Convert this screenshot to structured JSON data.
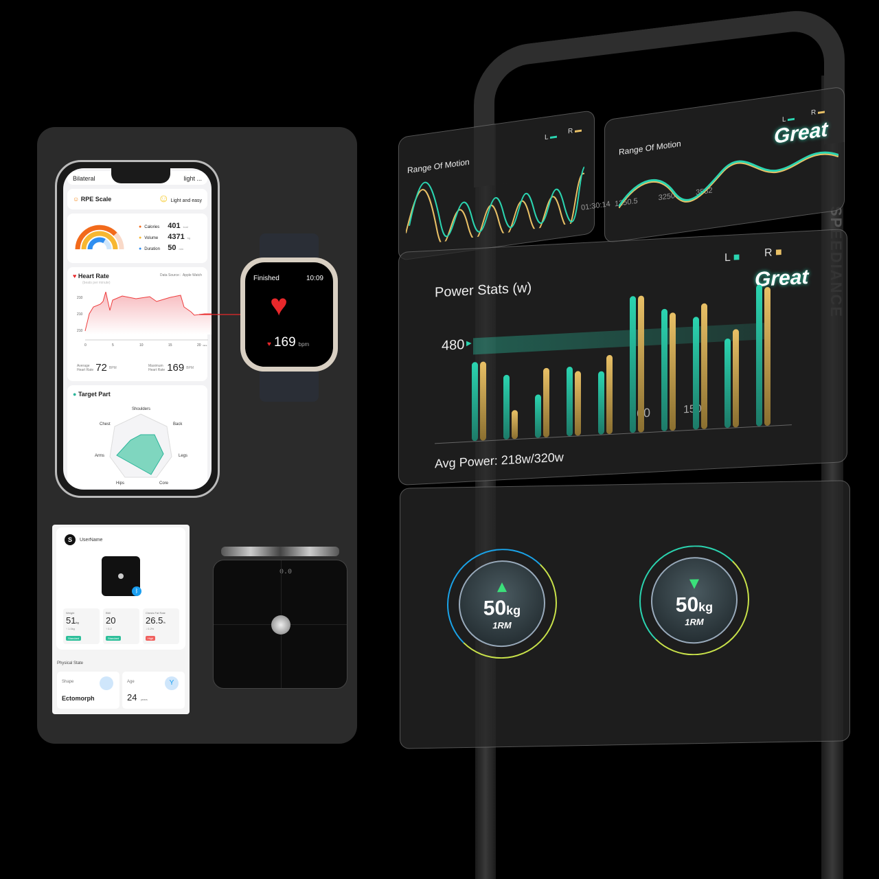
{
  "phone": {
    "header": {
      "left": "Bilateral",
      "right": "light ..."
    },
    "rpe": {
      "title": "RPE Scale",
      "value": "Light and easy"
    },
    "summary": [
      {
        "label": "Calories",
        "value": "401",
        "unit": "kcal",
        "color": "#f26a1b"
      },
      {
        "label": "Volume",
        "value": "4371",
        "unit": "kg",
        "color": "#f7b731"
      },
      {
        "label": "Duration",
        "value": "50",
        "unit": "min",
        "color": "#2f8ef0"
      }
    ],
    "heart": {
      "title": "Heart Rate",
      "subtitle": "(beats per minute)",
      "source": "Data Source：Apple Watch",
      "y_ticks": [
        "210",
        "210",
        "210"
      ],
      "x_ticks": [
        "0",
        "5",
        "10",
        "15",
        "20"
      ],
      "x_unit": "mins",
      "avg_label1": "Average",
      "avg_label2": "Heart Rate",
      "avg": "72",
      "avg_unit": "BPM",
      "max_label1": "Maximum",
      "max_label2": "Heart Rate",
      "max": "169",
      "max_unit": "BPM"
    },
    "target": {
      "title": "Target Part",
      "parts": [
        "Shoulders",
        "Back",
        "Legs",
        "Core",
        "Hips",
        "Arms",
        "Chest"
      ]
    }
  },
  "watch": {
    "status": "Finished",
    "time": "10:09",
    "bpm": "169",
    "unit": "bpm"
  },
  "scale_app": {
    "user": "UserName",
    "stats": [
      {
        "label": "Weight",
        "value": "51",
        "unit": "kg",
        "delta": "↑ 1.0kg",
        "badge": "Standard",
        "color": "#2dbf9a"
      },
      {
        "label": "BMI",
        "value": "20",
        "unit": "",
        "delta": "↑ 0.2",
        "badge": "Standard",
        "color": "#2dbf9a"
      },
      {
        "label": "Chests Fat Rate",
        "value": "26.5",
        "unit": "%",
        "delta": "↓ 0.2%",
        "badge": "High",
        "color": "#f0605e"
      }
    ],
    "physical": {
      "title": "Physical State",
      "shape_label": "Shape",
      "shape": "Ectomorph",
      "age_label": "Age",
      "age": "24",
      "age_unit": "years"
    }
  },
  "scale_display": "0.0",
  "rom1": {
    "title": "Range Of Motion",
    "l": "L",
    "r": "R"
  },
  "rom2": {
    "title": "Range Of Motion",
    "l": "L",
    "r": "R",
    "rating": "Great",
    "readouts": [
      "01:30:14",
      "1250.5",
      "3250",
      "3582"
    ]
  },
  "power": {
    "title": "Power Stats (w)",
    "l": "L",
    "r": "R",
    "rating": "Great",
    "ref": "480",
    "avg": "Avg Power:  218w/320w",
    "gauge": [
      "60",
      "150"
    ],
    "bars_l": [
      0.55,
      0.45,
      0.3,
      0.48,
      0.44,
      0.95,
      0.85,
      0.78,
      0.62,
      0.98
    ],
    "bars_r": [
      0.55,
      0.2,
      0.48,
      0.45,
      0.55,
      0.95,
      0.82,
      0.87,
      0.68,
      0.96
    ]
  },
  "rm": [
    {
      "value": "50",
      "unit": "kg",
      "label": "1RM",
      "dir": "up"
    },
    {
      "value": "50",
      "unit": "kg",
      "label": "1RM",
      "dir": "down"
    }
  ],
  "brand": "SPEEDIANCE",
  "colors": {
    "left": "#2bd4b0",
    "right": "#e8c066",
    "heart": "#e8282b"
  }
}
